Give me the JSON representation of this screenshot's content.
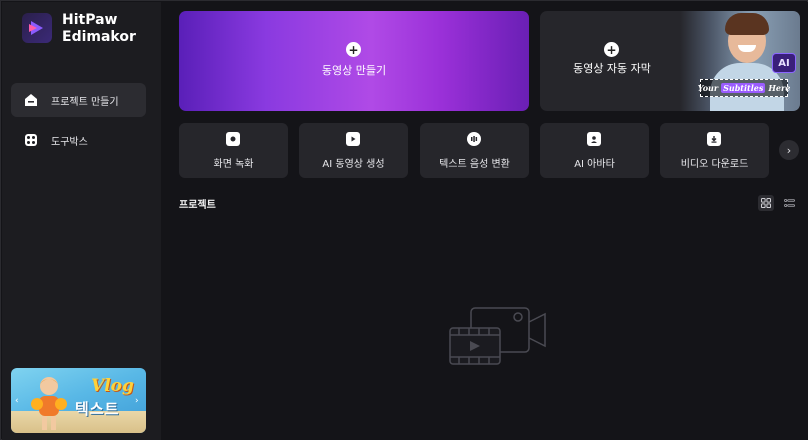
{
  "app": {
    "brand_line1": "HitPaw",
    "brand_line2": "Edimakor"
  },
  "sidebar": {
    "items": [
      {
        "label": "프로젝트 만들기",
        "icon": "home-icon",
        "active": true
      },
      {
        "label": "도구박스",
        "icon": "toolbox-icon",
        "active": false
      }
    ],
    "promo": {
      "title": "Vlog",
      "text": "텍스트"
    }
  },
  "main": {
    "create_card": {
      "label": "동영상 만들기",
      "icon": "plus-icon"
    },
    "subtitle_card": {
      "label": "동영상 자동 자막",
      "icon": "plus-icon",
      "ai_badge": "AI",
      "sample_subtitle_prefix": "Your",
      "sample_subtitle_highlight": "Subtitles",
      "sample_subtitle_suffix": "Here"
    },
    "tools": [
      {
        "label": "화면 녹화",
        "icon": "screen-record-icon"
      },
      {
        "label": "AI 동영상 생성",
        "icon": "ai-video-icon"
      },
      {
        "label": "텍스트 음성 변환",
        "icon": "text-to-speech-icon"
      },
      {
        "label": "AI 아바타",
        "icon": "avatar-icon"
      },
      {
        "label": "비디오 다운로드",
        "icon": "download-icon"
      }
    ],
    "projects_title": "프로젝트",
    "view_modes": [
      "grid-view-icon",
      "list-view-icon"
    ],
    "accent_color": "#9a3ae0"
  }
}
